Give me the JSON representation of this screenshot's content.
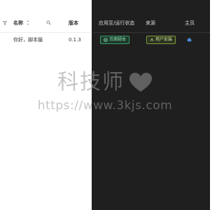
{
  "table": {
    "headers": {
      "name": "名称",
      "version": "版本",
      "apply_status": "应用至/运行状态",
      "source": "来源",
      "home": "主页"
    },
    "rows": [
      {
        "name": "你好，脚本猫",
        "version": "0.1.3",
        "status_badge": "页面脚本",
        "source_badge": "用户安装"
      }
    ]
  },
  "icons": {
    "filter": "filter-icon",
    "sort": "sort-icon",
    "search": "search-icon",
    "status": "page-script-icon",
    "source": "user-install-icon",
    "home": "home-icon"
  },
  "watermark": {
    "brand": "科技师",
    "url": "https://www.3kjs.com"
  },
  "colors": {
    "light_bg": "#ffffff",
    "dark_bg": "#1f1f1f",
    "status_green": "#3a9a65",
    "source_olive": "#7f9a3a",
    "home_blue": "#4a8ad6"
  }
}
